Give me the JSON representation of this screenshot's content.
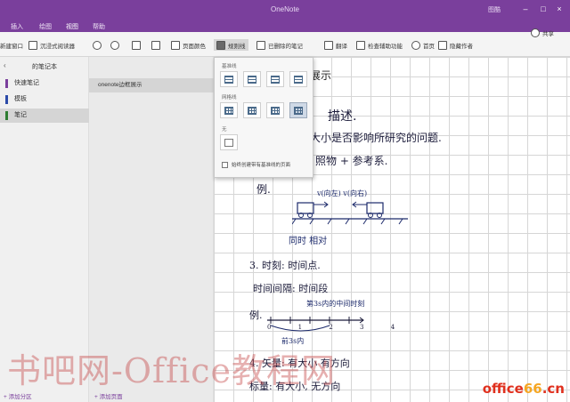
{
  "app": {
    "title": "OneNote",
    "user": "图酷",
    "window_buttons": [
      "–",
      "□",
      "×"
    ]
  },
  "menus": [
    "插入",
    "绘图",
    "视图",
    "帮助"
  ],
  "active_menu": "视图",
  "ribbon": {
    "items": [
      {
        "label": "新建窗口"
      },
      {
        "label": "沉浸式阅读器"
      },
      {
        "label": ""
      },
      {
        "label": ""
      },
      {
        "label": ""
      },
      {
        "label": ""
      },
      {
        "label": "页面颜色"
      },
      {
        "label": "规则线"
      },
      {
        "label": "隐藏作者"
      },
      {
        "label": "已删除的笔记"
      },
      {
        "label": "翻译"
      },
      {
        "label": "检查辅助功能"
      },
      {
        "label": "首页"
      },
      {
        "label": "隐藏作者"
      }
    ],
    "share_label": "共享"
  },
  "left_pane": {
    "notebook_name": "的笔记本",
    "sections": [
      {
        "label": "快速笔记",
        "color": "#7a3f9c"
      },
      {
        "label": "模板",
        "color": "#2b4aa8"
      },
      {
        "label": "笔记",
        "color": "#2e7d32"
      }
    ],
    "selected_section_index": 2,
    "add_section": "添加分区"
  },
  "page_pane": {
    "pages": [
      "onenote边框展示"
    ],
    "add_page": "添加页面"
  },
  "rule_lines_dropdown": {
    "group1_label": "基准线",
    "group2_label": "网格线",
    "group3_label": "无",
    "checkbox_label": "始终创建带有基准线的页面",
    "selected_group": "grid",
    "selected_tile_index": 3
  },
  "canvas": {
    "page_title": "展示",
    "handwriting": [
      "描述.",
      "大小是否影响所研究的问题.",
      "照物 + 参考系.",
      "例.",
      "v(向左)   v(向右)",
      "同时 相对",
      "3. 时刻: 时间点.",
      "时间间隔: 时间段",
      "第3s内的中间时刻",
      "例.",
      "0   1   2   3   4",
      "前3s内",
      "4. 矢量: 有大小  有方向",
      "标量: 有大小, 无方向"
    ]
  },
  "watermark": {
    "text": "书吧网-Office教程网",
    "site_prefix": "office",
    "site_highlight": "66",
    "site_suffix": ".cn"
  }
}
